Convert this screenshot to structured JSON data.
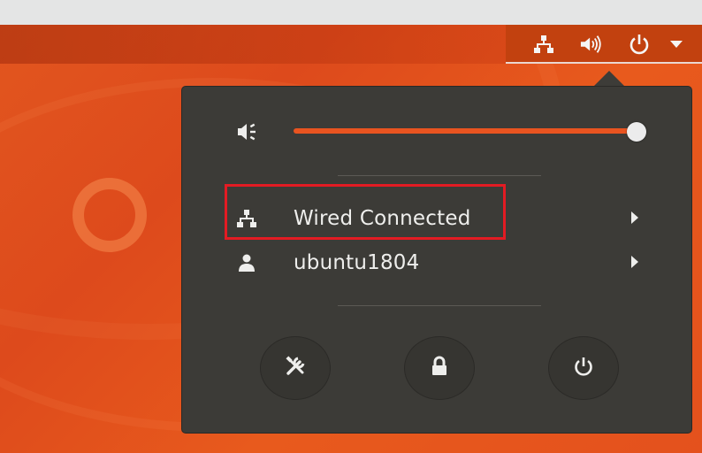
{
  "top_panel": {
    "indicators": [
      {
        "icon": "network-wired-icon"
      },
      {
        "icon": "volume-icon"
      },
      {
        "icon": "power-icon"
      },
      {
        "icon": "dropdown-arrow-icon"
      }
    ]
  },
  "system_menu": {
    "volume": {
      "icon": "volume-muted-icon",
      "level": 1.0
    },
    "items": [
      {
        "icon": "network-wired-icon",
        "label": "Wired Connected",
        "highlighted": true
      },
      {
        "icon": "user-icon",
        "label": "ubuntu1804",
        "highlighted": false
      }
    ],
    "buttons": [
      {
        "icon": "settings-tools-icon"
      },
      {
        "icon": "lock-icon"
      },
      {
        "icon": "power-off-icon"
      }
    ]
  },
  "colors": {
    "accent": "#e95420",
    "menu_background": "#3c3b37",
    "highlight_box": "#e31b23",
    "text": "#eeeeec"
  }
}
